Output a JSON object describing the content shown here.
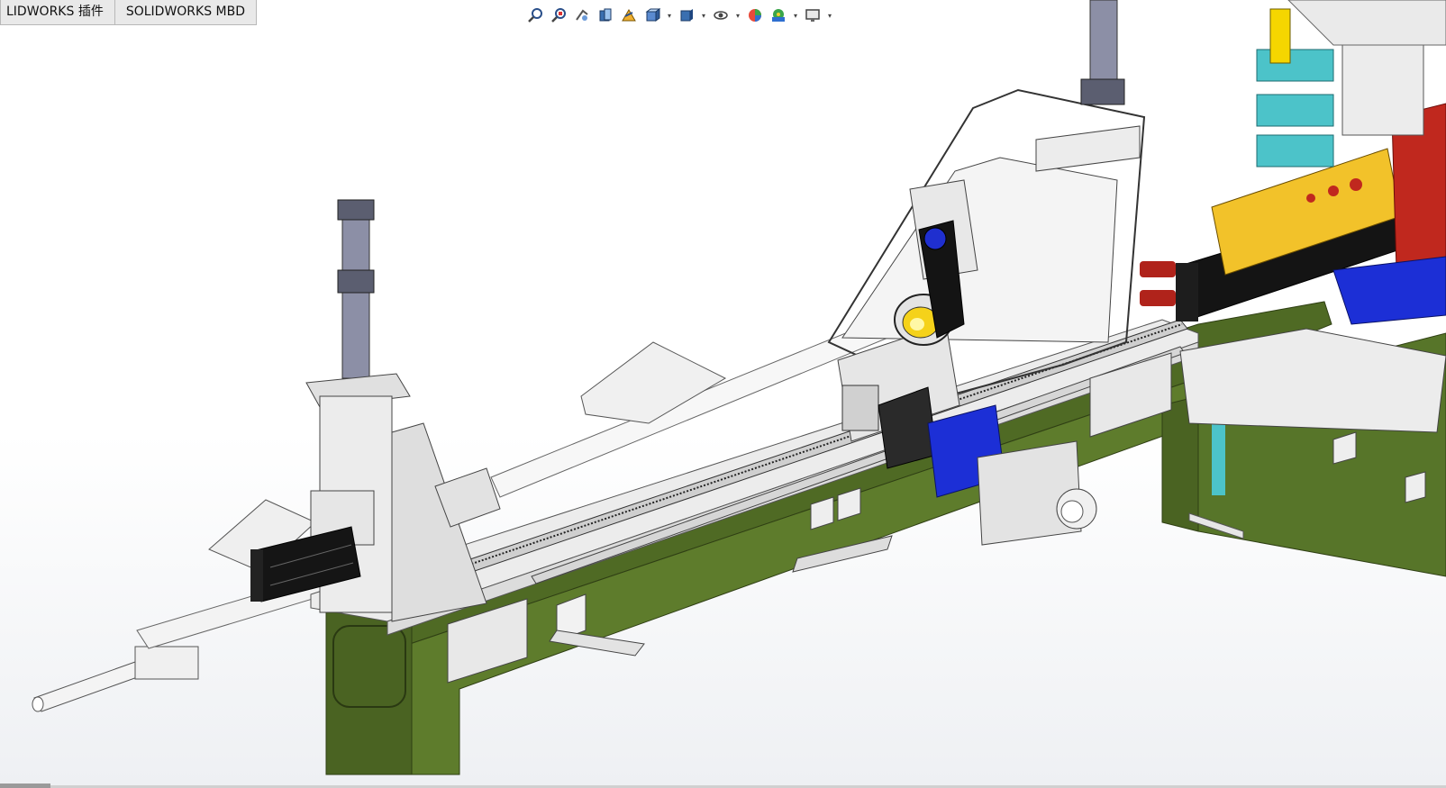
{
  "tabs": [
    {
      "label": "LIDWORKS 插件"
    },
    {
      "label": "SOLIDWORKS MBD"
    }
  ],
  "heads_up_toolbar": [
    {
      "icon": "zoom-to-fit-icon"
    },
    {
      "icon": "zoom-to-area-icon"
    },
    {
      "icon": "previous-view-icon"
    },
    {
      "icon": "section-view-icon"
    },
    {
      "icon": "dynamic-annotation-views-icon"
    },
    {
      "icon": "view-orientation-icon"
    },
    {
      "icon": "display-style-icon"
    },
    {
      "icon": "hide-show-items-icon"
    },
    {
      "icon": "edit-appearance-icon"
    },
    {
      "icon": "apply-scene-icon"
    },
    {
      "icon": "view-settings-icon"
    }
  ],
  "colors": {
    "frame_green": "#4f6a24",
    "frame_green_dark": "#3c521a",
    "sheet_metal": "#e6e6e6",
    "motor_blue": "#1c2fd6",
    "cylinder_black": "#151515",
    "yellow_plate": "#f2c22a",
    "red_part": "#c0281e",
    "teal_block": "#4cc3c9",
    "column_purple": "#8c8fa6"
  }
}
